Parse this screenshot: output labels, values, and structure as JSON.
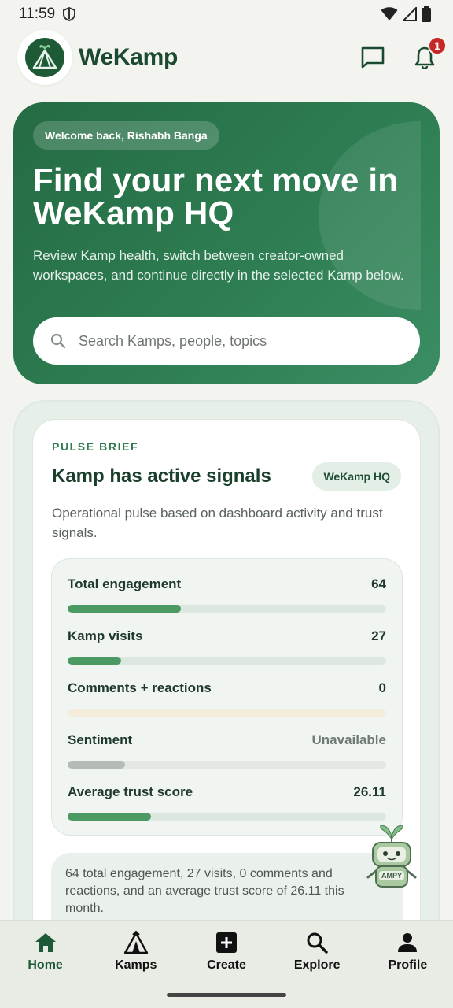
{
  "status_bar": {
    "time": "11:59"
  },
  "header": {
    "brand": "WeKamp",
    "notification_count": "1"
  },
  "hero": {
    "welcome": "Welcome back, Rishabh Banga",
    "title": "Find your next move in WeKamp HQ",
    "subtitle": "Review Kamp health, switch between creator-owned workspaces, and continue directly in the selected Kamp below.",
    "search_placeholder": "Search Kamps, people, topics"
  },
  "pulse": {
    "eyebrow": "PULSE BRIEF",
    "title": "Kamp has active signals",
    "scope": "WeKamp HQ",
    "description": "Operational pulse based on dashboard activity and trust signals.",
    "metrics": [
      {
        "label": "Total engagement",
        "value": "64",
        "fill_fraction": 0.355
      },
      {
        "label": "Kamp visits",
        "value": "27",
        "fill_fraction": 0.167
      },
      {
        "label": "Comments + reactions",
        "value": "0",
        "fill_fraction": 0
      },
      {
        "label": "Sentiment",
        "value": "Unavailable",
        "fill_fraction": 0.18
      },
      {
        "label": "Average trust score",
        "value": "26.11",
        "fill_fraction": 0.261
      }
    ],
    "summary": "64 total engagement, 27 visits, 0 comments and reactions, and an average trust score of 26.11 this month."
  },
  "mascot": {
    "label": "AMPY"
  },
  "nav": {
    "items": [
      {
        "label": "Home",
        "icon": "home-icon"
      },
      {
        "label": "Kamps",
        "icon": "tent-icon"
      },
      {
        "label": "Create",
        "icon": "add-box-icon"
      },
      {
        "label": "Explore",
        "icon": "search-icon"
      },
      {
        "label": "Profile",
        "icon": "person-icon"
      }
    ]
  },
  "colors": {
    "brand": "#1e5a36",
    "hero": "#2e7d52",
    "bar": "#4c9a63",
    "badge": "#c62828"
  }
}
